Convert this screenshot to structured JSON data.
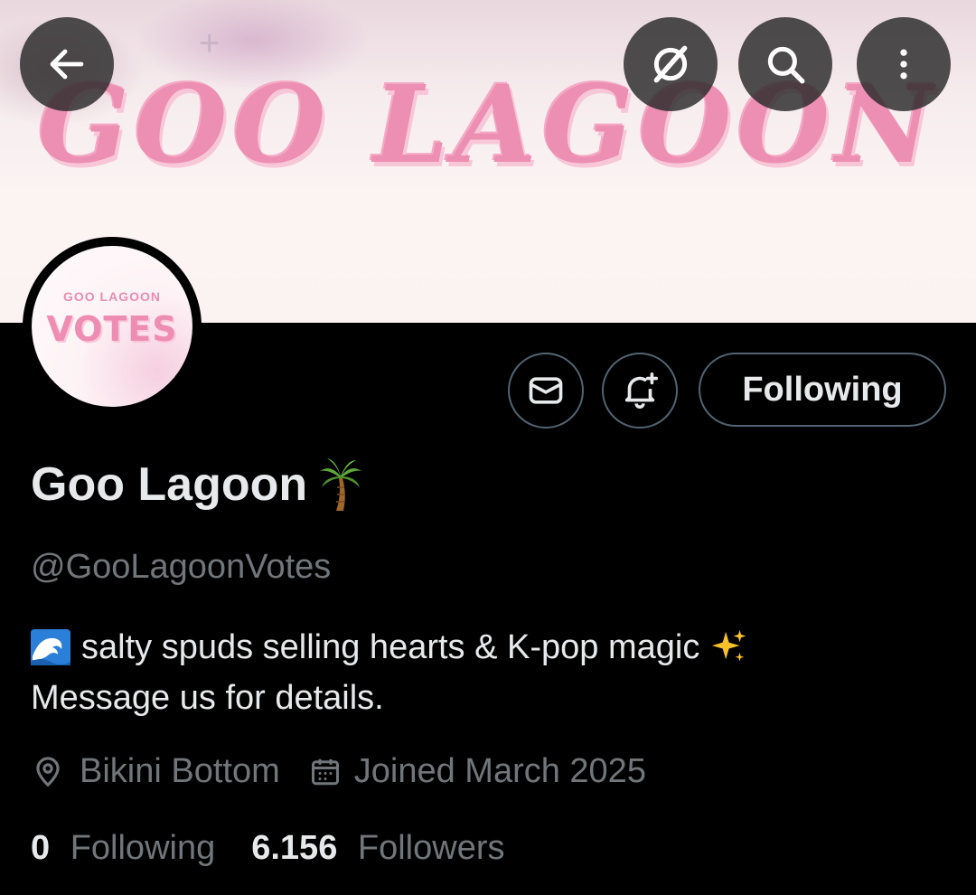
{
  "banner": {
    "text": "GOO LAGOON"
  },
  "topbar": {
    "back_icon": "arrow-left-icon",
    "grok_icon": "grok-icon",
    "search_icon": "search-icon",
    "more_icon": "more-vertical-icon"
  },
  "avatar": {
    "top_text": "GOO LAGOON",
    "main_text": "VOTES"
  },
  "actions": {
    "message_icon": "envelope-icon",
    "notify_icon": "bell-plus-icon",
    "following_label": "Following"
  },
  "profile": {
    "name": "Goo Lagoon",
    "name_emoji": "palm-tree-icon",
    "handle": "@GooLagoonVotes",
    "bio_line1": "salty spuds selling hearts & K-pop magic",
    "bio_line2": "Message us for details.",
    "bio_emoji_start": "wave-icon",
    "bio_emoji_end": "sparkles-icon",
    "location": "Bikini Bottom",
    "joined": "Joined March 2025",
    "following_count": "0",
    "following_label": "Following",
    "followers_count": "6.156",
    "followers_label": "Followers"
  },
  "colors": {
    "background": "#000000",
    "primary_text": "#e7e9ea",
    "secondary_text": "#71767b",
    "border": "#536471",
    "banner_pink": "#ec8fb2"
  }
}
